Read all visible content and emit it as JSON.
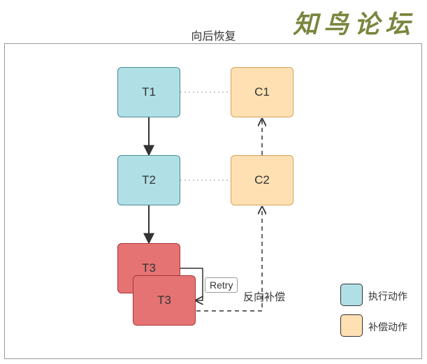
{
  "title": "向后恢复",
  "watermark": "知鸟论坛",
  "nodes": {
    "t1": "T1",
    "t2": "T2",
    "t3a": "T3",
    "t3b": "T3",
    "c1": "C1",
    "c2": "C2"
  },
  "labels": {
    "retry": "Retry",
    "reverse_compensate": "反向补偿"
  },
  "legend": {
    "exec": "执行动作",
    "comp": "补偿动作"
  },
  "chart_data": {
    "type": "diagram",
    "title": "向后恢复",
    "nodes": [
      {
        "id": "T1",
        "label": "T1",
        "kind": "execute",
        "color": "teal"
      },
      {
        "id": "T2",
        "label": "T2",
        "kind": "execute",
        "color": "teal"
      },
      {
        "id": "T3",
        "label": "T3",
        "kind": "execute_fail",
        "color": "red"
      },
      {
        "id": "T3_retry",
        "label": "T3",
        "kind": "execute_fail_retry",
        "color": "red"
      },
      {
        "id": "C2",
        "label": "C2",
        "kind": "compensate",
        "color": "orange"
      },
      {
        "id": "C1",
        "label": "C1",
        "kind": "compensate",
        "color": "orange"
      }
    ],
    "edges": [
      {
        "from": "T1",
        "to": "T2",
        "style": "solid"
      },
      {
        "from": "T2",
        "to": "T3",
        "style": "solid"
      },
      {
        "from": "T3",
        "to": "T3_retry",
        "style": "solid",
        "label": "Retry"
      },
      {
        "from": "T1",
        "to": "C1",
        "style": "dotted",
        "relation": "compensated_by"
      },
      {
        "from": "T2",
        "to": "C2",
        "style": "dotted",
        "relation": "compensated_by"
      },
      {
        "from": "T3_retry",
        "to": "C2",
        "style": "dashed",
        "label": "反向补偿"
      },
      {
        "from": "C2",
        "to": "C1",
        "style": "dashed"
      }
    ],
    "legend": [
      {
        "color": "teal",
        "label": "执行动作"
      },
      {
        "color": "orange",
        "label": "补偿动作"
      }
    ]
  }
}
